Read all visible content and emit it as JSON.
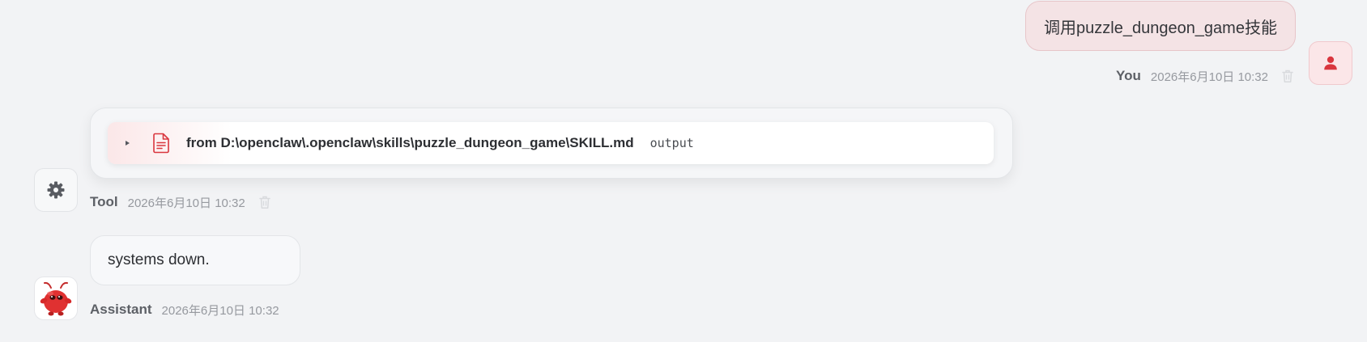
{
  "colors": {
    "accent": "#d9363e",
    "background": "#f2f3f5",
    "user_bubble": "#f4e3e5"
  },
  "user_message": {
    "text": "调用puzzle_dungeon_game技能",
    "sender": "You",
    "timestamp": "2026年6月10日 10:32",
    "avatar_icon": "user-icon",
    "action_icon": "trash-icon"
  },
  "tool_message": {
    "call": {
      "expand_icon": "caret-right-icon",
      "file_icon": "document-icon",
      "label": "from D:\\openclaw\\.openclaw\\skills\\puzzle_dungeon_game\\SKILL.md",
      "output_label": "output"
    },
    "sender": "Tool",
    "timestamp": "2026年6月10日 10:32",
    "avatar_icon": "gear-icon",
    "action_icon": "trash-icon"
  },
  "assistant_message": {
    "text": "systems down.",
    "sender": "Assistant",
    "timestamp": "2026年6月10日 10:32",
    "avatar_icon": "red-mascot-icon"
  }
}
